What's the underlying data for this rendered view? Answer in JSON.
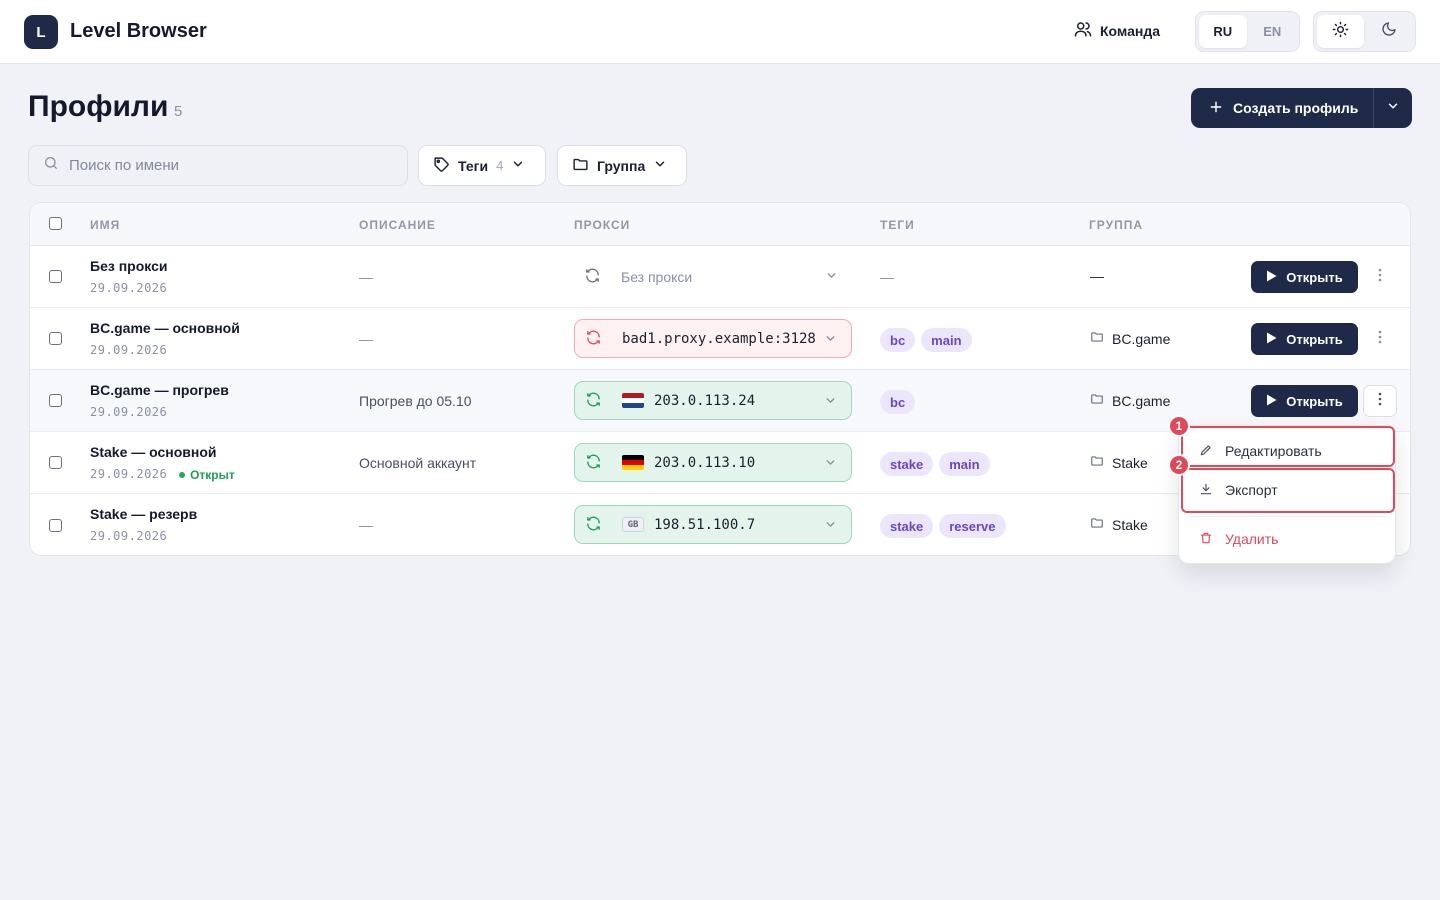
{
  "header": {
    "logo_letter": "L",
    "app_title": "Level Browser",
    "team_label": "Команда",
    "languages": [
      "RU",
      "EN"
    ],
    "active_language": "RU"
  },
  "page": {
    "title": "Профили",
    "count": "5",
    "create_button": "Создать профиль"
  },
  "filters": {
    "search_placeholder": "Поиск по имени",
    "tags_label": "Теги",
    "tags_count": "4",
    "group_label": "Группа"
  },
  "table": {
    "columns": [
      "ИМЯ",
      "ОПИСАНИЕ",
      "ПРОКСИ",
      "ТЕГИ",
      "ГРУППА"
    ],
    "open_label": "Открыть",
    "rows": [
      {
        "name": "Без прокси",
        "date": "29.09.2026",
        "status": "",
        "description": "—",
        "proxy": "Без прокси",
        "proxy_state": "none",
        "flag": "",
        "tags": [],
        "tags_empty": "—",
        "group": "—"
      },
      {
        "name": "BC.game — основной",
        "date": "29.09.2026",
        "status": "",
        "description": "—",
        "proxy": "bad1.proxy.example:3128",
        "proxy_state": "bad",
        "flag": "",
        "tags": [
          "bc",
          "main"
        ],
        "tags_empty": "",
        "group": "BC.game"
      },
      {
        "name": "BC.game — прогрев",
        "date": "29.09.2026",
        "status": "",
        "description": "Прогрев до 05.10",
        "proxy": "203.0.113.24",
        "proxy_state": "ok",
        "flag": "NL",
        "tags": [
          "bc"
        ],
        "tags_empty": "",
        "group": "BC.game"
      },
      {
        "name": "Stake — основной",
        "date": "29.09.2026",
        "status": "Открыт",
        "description": "Основной аккаунт",
        "proxy": "203.0.113.10",
        "proxy_state": "ok",
        "flag": "DE",
        "tags": [
          "stake",
          "main"
        ],
        "tags_empty": "",
        "group": "Stake"
      },
      {
        "name": "Stake — резерв",
        "date": "29.09.2026",
        "status": "",
        "description": "—",
        "proxy": "198.51.100.7",
        "proxy_state": "ok",
        "flag": "GB",
        "tags": [
          "stake",
          "reserve"
        ],
        "tags_empty": "",
        "group": "Stake"
      }
    ]
  },
  "context_menu": {
    "edit": "Редактировать",
    "export": "Экспорт",
    "delete": "Удалить",
    "badges": [
      "1",
      "2"
    ]
  },
  "colors": {
    "brand": "#1e2a47",
    "tag_bg": "#ece6fb",
    "tag_text": "#6b45c6",
    "proxy_ok": "#e3f4ec",
    "proxy_bad": "#fdf1f2",
    "danger": "#e0475b",
    "highlight": "#e04a58",
    "status_open": "#1f9d55"
  }
}
